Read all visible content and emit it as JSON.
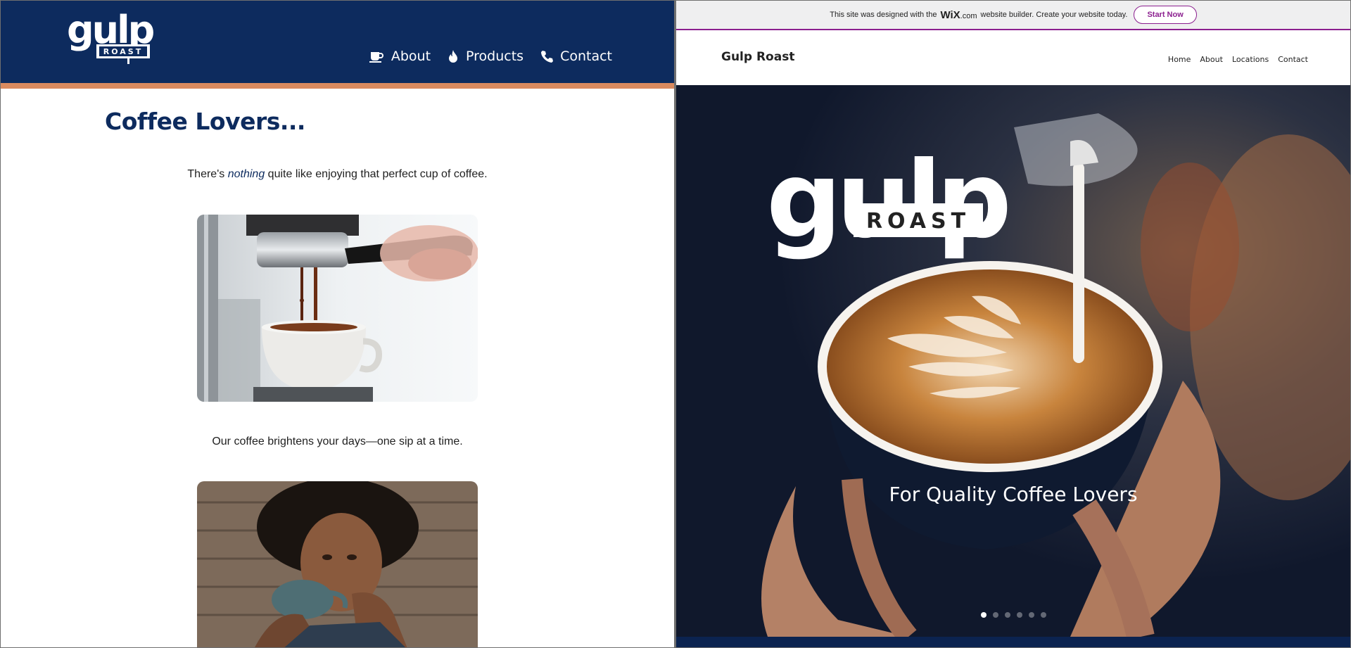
{
  "left": {
    "logo": {
      "word": "gulp",
      "sub": "ROAST"
    },
    "nav": [
      {
        "label": "About",
        "icon": "coffee-cup-icon"
      },
      {
        "label": "Products",
        "icon": "flame-icon"
      },
      {
        "label": "Contact",
        "icon": "phone-icon"
      }
    ],
    "title": "Coffee Lovers...",
    "intro_before": "There's",
    "intro_emphasis": "nothing",
    "intro_after": "quite like enjoying that perfect cup of coffee.",
    "caption": "Our coffee brightens your days—one sip at a time.",
    "colors": {
      "header": "#0d2b5e",
      "stripe": "#d98a5f"
    }
  },
  "right": {
    "banner": {
      "text_before": "This site was designed with the",
      "brand": "WiX",
      "brand_suffix": ".com",
      "text_after": "website builder. Create your website today.",
      "cta": "Start Now"
    },
    "site_name": "Gulp Roast",
    "nav": [
      "Home",
      "About",
      "Locations",
      "Contact"
    ],
    "hero": {
      "logo_word": "gulp",
      "logo_sub": "ROAST",
      "tagline": "For Quality Coffee Lovers",
      "slides": 6,
      "active_slide": 1
    },
    "colors": {
      "accent": "#8b1f8f",
      "footer": "#0b2350"
    }
  }
}
